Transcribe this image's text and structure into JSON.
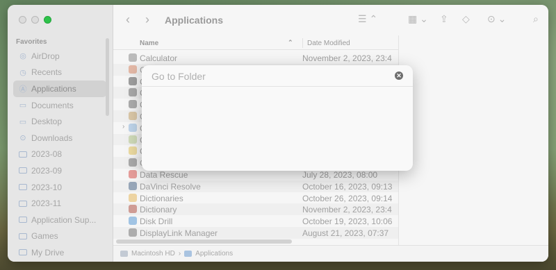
{
  "window": {
    "title": "Applications"
  },
  "sidebar": {
    "heading": "Favorites",
    "items": [
      {
        "label": "AirDrop",
        "icon": "airdrop-icon",
        "glyph": "◎"
      },
      {
        "label": "Recents",
        "icon": "clock-icon",
        "glyph": "◷"
      },
      {
        "label": "Applications",
        "icon": "applications-icon",
        "glyph": "Ⓐ"
      },
      {
        "label": "Documents",
        "icon": "document-icon",
        "glyph": "▭"
      },
      {
        "label": "Desktop",
        "icon": "desktop-icon",
        "glyph": "▭"
      },
      {
        "label": "Downloads",
        "icon": "download-icon",
        "glyph": "⊙"
      },
      {
        "label": "2023-08",
        "icon": "folder-icon",
        "glyph": ""
      },
      {
        "label": "2023-09",
        "icon": "folder-icon",
        "glyph": ""
      },
      {
        "label": "2023-10",
        "icon": "folder-icon",
        "glyph": ""
      },
      {
        "label": "2023-11",
        "icon": "folder-icon",
        "glyph": ""
      },
      {
        "label": "Application Sup...",
        "icon": "folder-icon",
        "glyph": ""
      },
      {
        "label": "Games",
        "icon": "folder-icon",
        "glyph": ""
      },
      {
        "label": "My Drive",
        "icon": "folder-icon",
        "glyph": ""
      }
    ]
  },
  "columns": {
    "name": "Name",
    "date_modified": "Date Modified"
  },
  "files": [
    {
      "name": "Calculator",
      "date": "November 2, 2023, 23:4",
      "icon_color": "#8a8a8a"
    },
    {
      "name": "C",
      "date": "",
      "icon_color": "#d98b6a"
    },
    {
      "name": "C",
      "date": "",
      "icon_color": "#555555"
    },
    {
      "name": "C",
      "date": "",
      "icon_color": "#6d6d6d"
    },
    {
      "name": "C",
      "date": "",
      "icon_color": "#707070"
    },
    {
      "name": "C",
      "date": "",
      "icon_color": "#c9a66b"
    },
    {
      "name": "C",
      "date": "",
      "icon_color": "#8fb8e0",
      "disclosure": true
    },
    {
      "name": "C",
      "date": "",
      "icon_color": "#b4c98a"
    },
    {
      "name": "C",
      "date": "",
      "icon_color": "#e3c25a"
    },
    {
      "name": "C",
      "date": "",
      "icon_color": "#707070"
    },
    {
      "name": "Data Rescue",
      "date": "July 28, 2023, 08:00",
      "icon_color": "#d9534f"
    },
    {
      "name": "DaVinci Resolve",
      "date": "October 16, 2023, 09:13",
      "icon_color": "#4e6a8a"
    },
    {
      "name": "Dictionaries",
      "date": "October 26, 2023, 09:14",
      "icon_color": "#e6b85c"
    },
    {
      "name": "Dictionary",
      "date": "November 2, 2023, 23:4",
      "icon_color": "#b5584a"
    },
    {
      "name": "Disk Drill",
      "date": "October 19, 2023, 10:06",
      "icon_color": "#5b9bd5"
    },
    {
      "name": "DisplayLink Manager",
      "date": "August 21, 2023, 07:37",
      "icon_color": "#777777"
    }
  ],
  "pathbar": {
    "drive": "Macintosh HD",
    "separator": "›",
    "folder": "Applications"
  },
  "dialog": {
    "placeholder": "Go to Folder",
    "close_glyph": "✕"
  },
  "toolbar": {
    "back_glyph": "‹",
    "forward_glyph": "›"
  }
}
